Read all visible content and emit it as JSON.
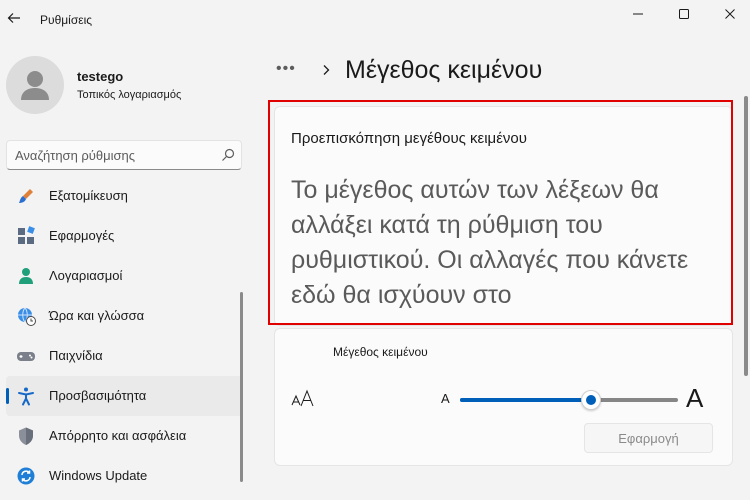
{
  "app": {
    "title": "Ρυθμίσεις"
  },
  "profile": {
    "name": "testego",
    "account_type": "Τοπικός λογαριασμός"
  },
  "search": {
    "placeholder": "Αναζήτηση ρύθμισης"
  },
  "nav": {
    "items": [
      {
        "label": "Εξατομίκευση",
        "icon": "paintbrush-icon"
      },
      {
        "label": "Εφαρμογές",
        "icon": "apps-icon"
      },
      {
        "label": "Λογαριασμοί",
        "icon": "person-icon"
      },
      {
        "label": "Ώρα και γλώσσα",
        "icon": "globe-clock-icon"
      },
      {
        "label": "Παιχνίδια",
        "icon": "gamepad-icon"
      },
      {
        "label": "Προσβασιμότητα",
        "icon": "accessibility-icon",
        "active": true
      },
      {
        "label": "Απόρρητο και ασφάλεια",
        "icon": "shield-icon"
      },
      {
        "label": "Windows Update",
        "icon": "update-icon"
      }
    ]
  },
  "breadcrumb": {
    "more": "•••",
    "page_title": "Μέγεθος κειμένου"
  },
  "preview": {
    "title": "Προεπισκόπηση μεγέθους κειμένου",
    "body": "Το μέγεθος αυτών των λέξεων θα αλλάξει κατά τη ρύθμιση του ρυθμιστικού. Οι αλλαγές που κάνετε εδώ θα ισχύουν στο"
  },
  "text_size": {
    "label": "Μέγεθος κειμένου",
    "small_glyph": "A",
    "large_glyph": "A",
    "slider_fraction": 0.6,
    "apply_label": "Εφαρμογή"
  },
  "colors": {
    "accent": "#005fb8",
    "highlight_border": "#e00000"
  }
}
